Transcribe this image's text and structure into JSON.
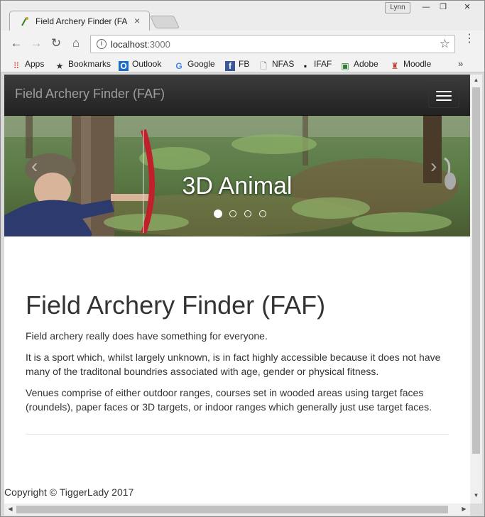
{
  "browser": {
    "tab_title": "Field Archery Finder (FAF)",
    "tab_close": "×",
    "user_badge": "Lynn",
    "window_controls": {
      "minimize": "—",
      "restore": "❐",
      "close": "✕"
    },
    "nav": {
      "back": "←",
      "forward": "→",
      "reload": "↻",
      "home": "⌂"
    },
    "url_host": "localhost",
    "url_port": ":3000",
    "info_icon": "i",
    "star_icon": "☆",
    "menu_icon": "⋮",
    "bookmarks": [
      {
        "label": "Apps",
        "icon": "apps-grid-icon",
        "glyph": "⠿",
        "color": "#d04a3a"
      },
      {
        "label": "Bookmarks",
        "icon": "star-icon",
        "glyph": "★",
        "color": "#333333"
      },
      {
        "label": "Outlook",
        "icon": "outlook-icon",
        "glyph": "O",
        "color": "#1b6ec2"
      },
      {
        "label": "Google",
        "icon": "google-icon",
        "glyph": "G",
        "color": "#4285f4"
      },
      {
        "label": "FB",
        "icon": "facebook-icon",
        "glyph": "f",
        "color": "#3b5998"
      },
      {
        "label": "NFAS",
        "icon": "page-icon",
        "glyph": "🗋",
        "color": "#666666"
      },
      {
        "label": "IFAF",
        "icon": "bbc-icon",
        "glyph": "▪",
        "color": "#111111"
      },
      {
        "label": "Adobe",
        "icon": "adobe-icon",
        "glyph": "▣",
        "color": "#2e7d32"
      },
      {
        "label": "Moodle",
        "icon": "moodle-icon",
        "glyph": "♜",
        "color": "#c0392b"
      }
    ],
    "bookmarks_more": "»"
  },
  "navbar": {
    "brand": "Field Archery Finder (FAF)"
  },
  "carousel": {
    "caption": "3D Animal",
    "prev": "‹",
    "next": "›",
    "slide_count": 4,
    "active_slide": 1
  },
  "main": {
    "title": "Field Archery Finder (FAF)",
    "paragraphs": [
      "Field archery really does have something for everyone.",
      "It is a sport which, whilst largely unknown, is in fact highly accessible because it does not have many of the traditonal boundries associated with age, gender or physical fitness.",
      "Venues comprise of either outdoor ranges, courses set in wooded areas using target faces (roundels), paper faces or 3D targets, or indoor ranges which generally just use target faces."
    ]
  },
  "footer": {
    "copyright": "Copyright © TiggerLady 2017"
  }
}
